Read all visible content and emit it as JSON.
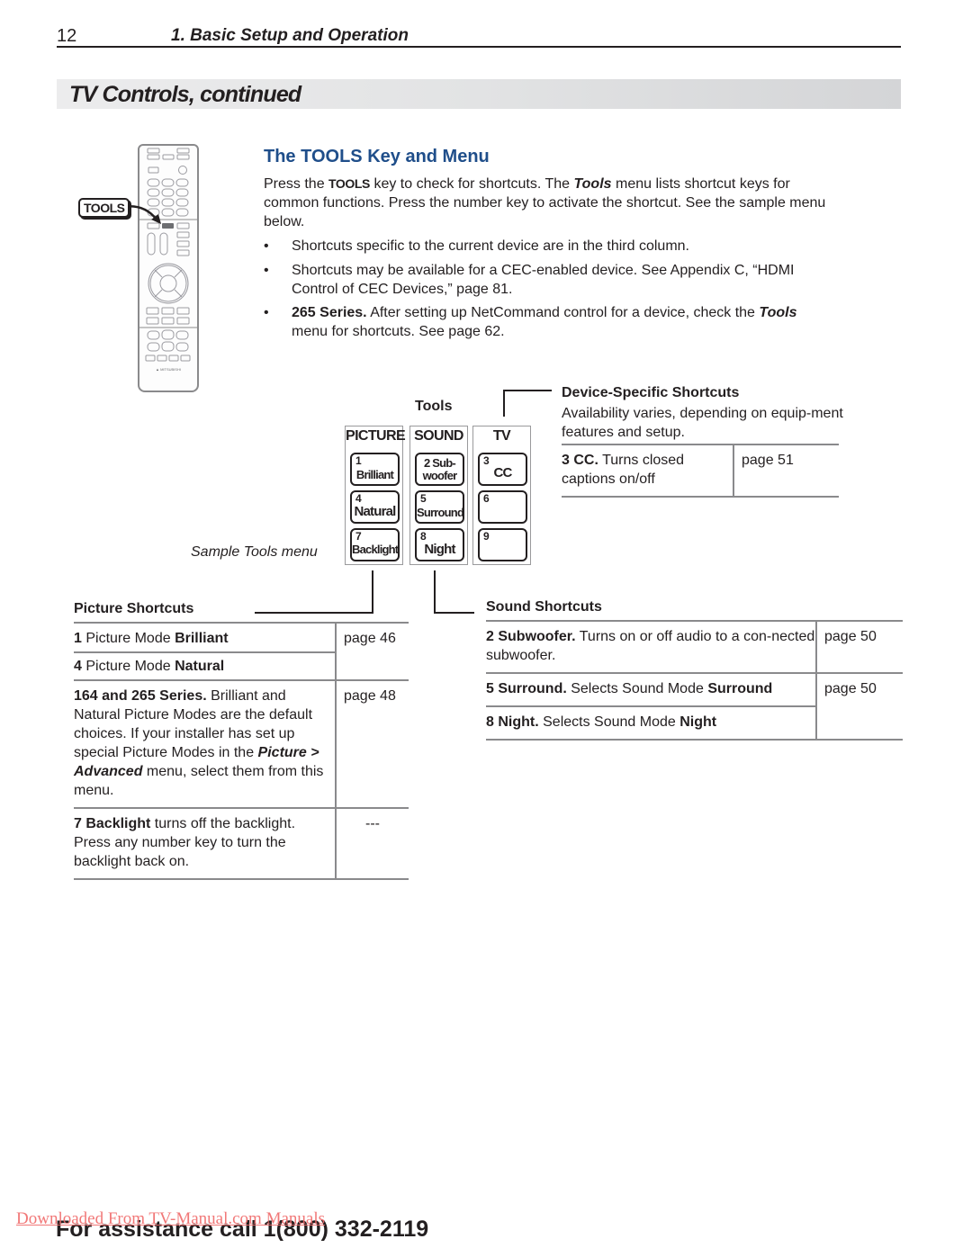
{
  "header": {
    "page_number": "12",
    "chapter_title": "1.  Basic Setup and Operation"
  },
  "section": {
    "title": "TV Controls, continued"
  },
  "remote": {
    "callout_label": "TOOLS"
  },
  "intro": {
    "heading": "The TOOLS Key and Menu",
    "p1_a": "Press the ",
    "p1_key": "TOOLS",
    "p1_b": " key to check for shortcuts.  The ",
    "p1_menu": "Tools",
    "p1_c": " menu lists shortcut keys for common functions.  Press the number key to activate the shortcut.  See the sample menu below.",
    "bullets": [
      {
        "bold": "",
        "text": "Shortcuts specific to the current device are in the third column."
      },
      {
        "bold": "",
        "text": "Shortcuts may be available for a CEC-enabled device.  See Appendix C, “HDMI Control of CEC Devices,” page 81."
      },
      {
        "bold": "265 Series.",
        "text_a": "  After setting up NetCommand control for a device, check the ",
        "italic": "Tools",
        "text_b": " menu for shortcuts.  See page 62."
      }
    ]
  },
  "tools_menu": {
    "label": "Tools",
    "sample_caption": "Sample Tools menu",
    "columns": [
      {
        "header": "PICTURE",
        "keys": [
          {
            "number": "1",
            "label": "Brilliant"
          },
          {
            "number": "4",
            "label": "Natural"
          },
          {
            "number": "7",
            "label": "Backlight"
          }
        ]
      },
      {
        "header": "SOUND",
        "keys": [
          {
            "number": "2",
            "label": "Sub-woofer",
            "line1": "2 Sub-",
            "line2": "woofer"
          },
          {
            "number": "5",
            "label": "Surround"
          },
          {
            "number": "8",
            "label": "Night"
          }
        ]
      },
      {
        "header": "TV",
        "keys": [
          {
            "number": "3",
            "label": "CC"
          },
          {
            "number": "6",
            "label": ""
          },
          {
            "number": "9",
            "label": ""
          }
        ]
      }
    ]
  },
  "device_shortcuts": {
    "title": "Device-Specific Shortcuts",
    "description": "Availability varies, depending on equip-ment features and setup.",
    "rows": [
      {
        "bold": "3  CC.",
        "text": "  Turns closed captions on/off",
        "page": "page 51"
      }
    ]
  },
  "picture_shortcuts": {
    "title": "Picture Shortcuts",
    "rows": [
      {
        "num": "1",
        "text": "  Picture Mode ",
        "bold": "Brilliant",
        "page": "page 46"
      },
      {
        "num": "4",
        "text": "  Picture Mode ",
        "bold": "Natural",
        "page": ""
      },
      {
        "lead": "164 and 265 Series.",
        "text_a": "  Brilliant and Natural Picture Modes are the default choices.  If your installer has set up special Picture Modes in the ",
        "italic": "Picture > Advanced",
        "text_b": " menu, select them from this menu.",
        "page": "page 48"
      },
      {
        "lead": "7  Backlight",
        "text_a": " turns off the backlight. Press any number key to turn the backlight back on.",
        "page": "---"
      }
    ]
  },
  "sound_shortcuts": {
    "title": "Sound Shortcuts",
    "rows": [
      {
        "lead": "2  Subwoofer.",
        "text": "  Turns on or off audio to a con-nected subwoofer.",
        "page": "page 50"
      },
      {
        "lead": "5  Surround.",
        "text": "  Selects Sound Mode ",
        "bold": "Surround",
        "page": "page 50"
      },
      {
        "lead": "8  Night.",
        "text": "  Selects Sound Mode ",
        "bold": "Night",
        "page": ""
      }
    ]
  },
  "footer": {
    "assistance": "For assistance call 1(800) 332-2119",
    "watermark": "Downloaded From TV-Manual.com Manuals"
  },
  "colors": {
    "heading_blue": "#1f4e8a",
    "text": "#231f20",
    "rule_gray": "#8a8a8c",
    "watermark_red": "#f06a6a"
  }
}
